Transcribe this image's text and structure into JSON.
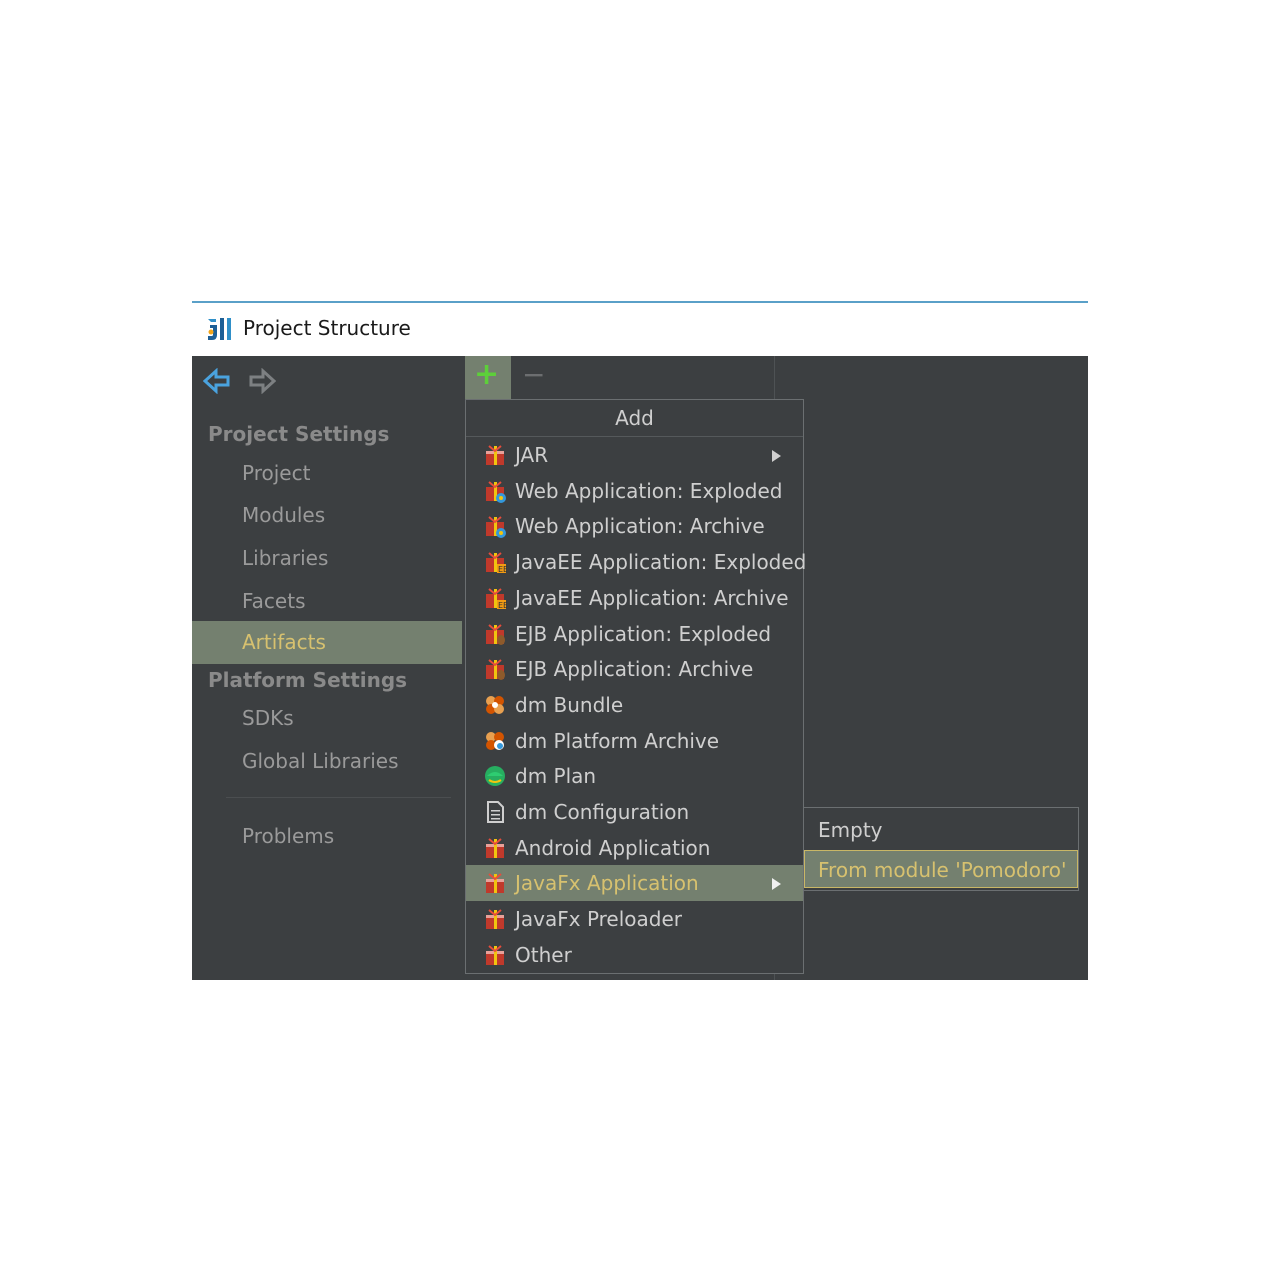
{
  "window": {
    "title": "Project Structure"
  },
  "nav": {
    "back_icon": "arrow-left-icon",
    "forward_icon": "arrow-right-icon"
  },
  "sidebar": {
    "project_settings_header": "Project Settings",
    "project_items": [
      {
        "label": "Project"
      },
      {
        "label": "Modules"
      },
      {
        "label": "Libraries"
      },
      {
        "label": "Facets"
      },
      {
        "label": "Artifacts",
        "selected": true
      }
    ],
    "platform_settings_header": "Platform Settings",
    "platform_items": [
      {
        "label": "SDKs"
      },
      {
        "label": "Global Libraries"
      }
    ],
    "problems_label": "Problems"
  },
  "toolbar": {
    "add_symbol": "+",
    "remove_symbol": "−"
  },
  "add_menu": {
    "header": "Add",
    "items": [
      {
        "label": "JAR",
        "icon": "artifact-icon",
        "submenu": true
      },
      {
        "label": "Web Application: Exploded",
        "icon": "web-artifact-icon"
      },
      {
        "label": "Web Application: Archive",
        "icon": "web-artifact-icon"
      },
      {
        "label": "JavaEE Application: Exploded",
        "icon": "javaee-artifact-icon"
      },
      {
        "label": "JavaEE Application: Archive",
        "icon": "javaee-artifact-icon"
      },
      {
        "label": "EJB Application: Exploded",
        "icon": "ejb-artifact-icon"
      },
      {
        "label": "EJB Application: Archive",
        "icon": "ejb-artifact-icon"
      },
      {
        "label": "dm Bundle",
        "icon": "bundle-icon"
      },
      {
        "label": "dm Platform Archive",
        "icon": "platform-archive-icon"
      },
      {
        "label": "dm Plan",
        "icon": "plan-icon"
      },
      {
        "label": "dm Configuration",
        "icon": "document-icon"
      },
      {
        "label": "Android Application",
        "icon": "artifact-icon"
      },
      {
        "label": "JavaFx Application",
        "icon": "artifact-icon",
        "submenu": true,
        "highlighted": true
      },
      {
        "label": "JavaFx Preloader",
        "icon": "artifact-icon"
      },
      {
        "label": "Other",
        "icon": "artifact-icon"
      }
    ]
  },
  "javafx_submenu": {
    "items": [
      {
        "label": "Empty"
      },
      {
        "label": "From module 'Pomodoro'",
        "highlighted": true
      }
    ]
  },
  "colors": {
    "background": "#3c3f41",
    "selection": "#74806f",
    "selected_text": "#d7c16f",
    "add_green": "#5dcf3a"
  }
}
